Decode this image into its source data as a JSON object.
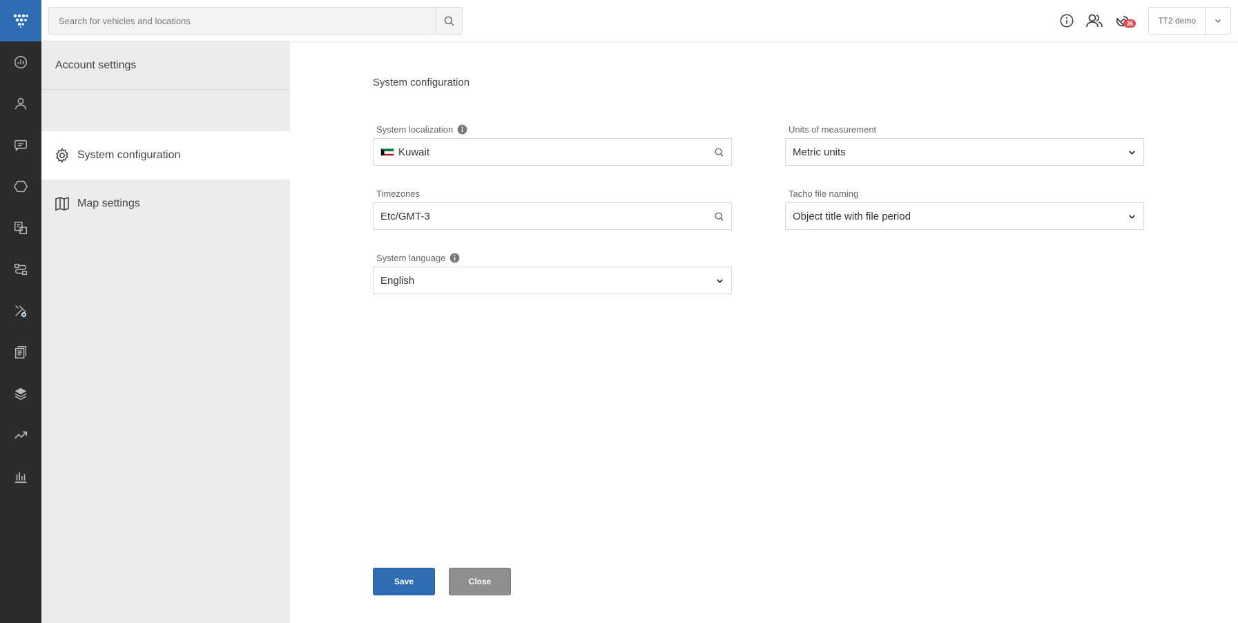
{
  "search": {
    "placeholder": "Search for vehicles and locations"
  },
  "header": {
    "notifications_count": "36",
    "user_name": "TT2 demo"
  },
  "sidebar": {
    "title": "Account settings",
    "items": [
      {
        "label": "System configuration",
        "icon": "gear-icon",
        "active": true
      },
      {
        "label": "Map settings",
        "icon": "map-icon",
        "active": false
      }
    ]
  },
  "main": {
    "title": "System configuration",
    "fields": {
      "localization": {
        "label": "System localization",
        "value": "Kuwait"
      },
      "units": {
        "label": "Units of measurement",
        "value": "Metric units"
      },
      "timezones": {
        "label": "Timezones",
        "value": "Etc/GMT-3"
      },
      "tacho": {
        "label": "Tacho file naming",
        "value": "Object title with file period"
      },
      "language": {
        "label": "System language",
        "value": "English"
      }
    },
    "buttons": {
      "save": "Save",
      "close": "Close"
    }
  },
  "colors": {
    "accent": "#2f6db3",
    "rail": "#2b2b2b",
    "sidebar": "#ececec",
    "badge": "#e0474c"
  }
}
